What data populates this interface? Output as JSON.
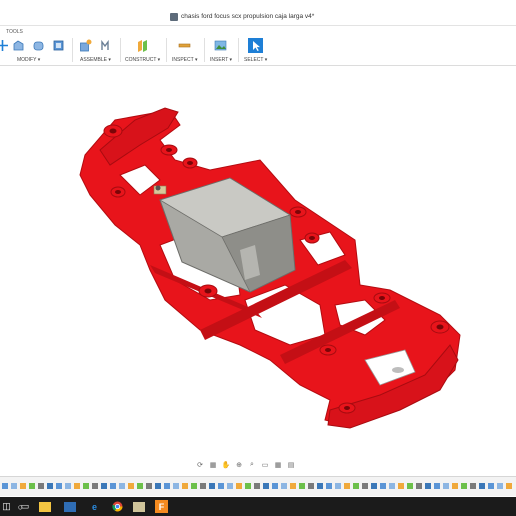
{
  "window": {
    "title": "chasis ford focus scx propulsion caja larga v4*"
  },
  "toolbar": {
    "section_label": "TOOLS",
    "groups": [
      {
        "label": "MODIFY ▾"
      },
      {
        "label": "ASSEMBLE ▾"
      },
      {
        "label": "CONSTRUCT ▾"
      },
      {
        "label": "INSPECT ▾"
      },
      {
        "label": "INSERT ▾"
      },
      {
        "label": "SELECT ▾"
      }
    ],
    "accent_color": "#1e7fd6"
  },
  "viewport": {
    "model_color": "#e8141b",
    "motor_color": "#a9a9a4"
  },
  "navbar": {
    "icons": [
      "orbit-icon",
      "look-at-icon",
      "pan-icon",
      "zoom-icon",
      "fit-icon",
      "display-settings-icon",
      "grid-icon",
      "viewport-icon"
    ]
  },
  "taskbar": {
    "apps": [
      "start-icon",
      "search-icon",
      "task-view-icon",
      "file-explorer-icon",
      "folder-icon",
      "edge-icon",
      "chrome-icon",
      "files-icon",
      "fusion-icon"
    ],
    "fusion_label": "F"
  }
}
